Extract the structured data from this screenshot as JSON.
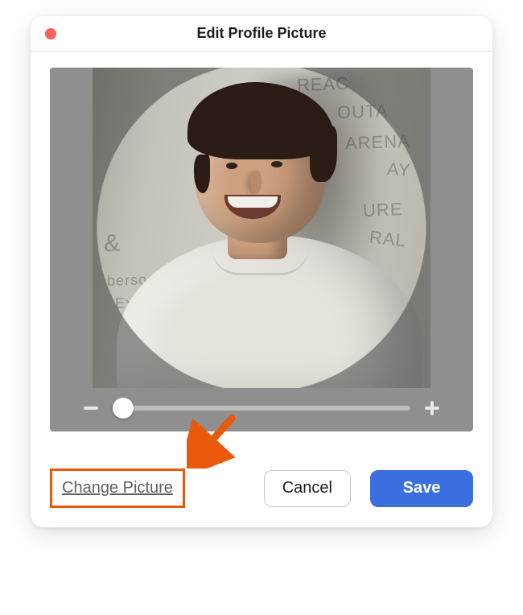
{
  "titlebar": {
    "title": "Edit Profile Picture"
  },
  "editor": {
    "zoom_minus_label": "zoom out",
    "zoom_plus_label": "zoom in",
    "slider_value_pct": 0
  },
  "actions": {
    "change_picture": "Change Picture",
    "cancel": "Cancel",
    "save": "Save"
  },
  "annotation": {
    "highlight_target": "change-picture-button",
    "arrow_color": "#e8590c"
  },
  "colors": {
    "close_dot": "#ff5f57",
    "primary_button": "#3b6fe0",
    "highlight_border": "#e8590c",
    "panel_bg": "#8f8f8f"
  }
}
